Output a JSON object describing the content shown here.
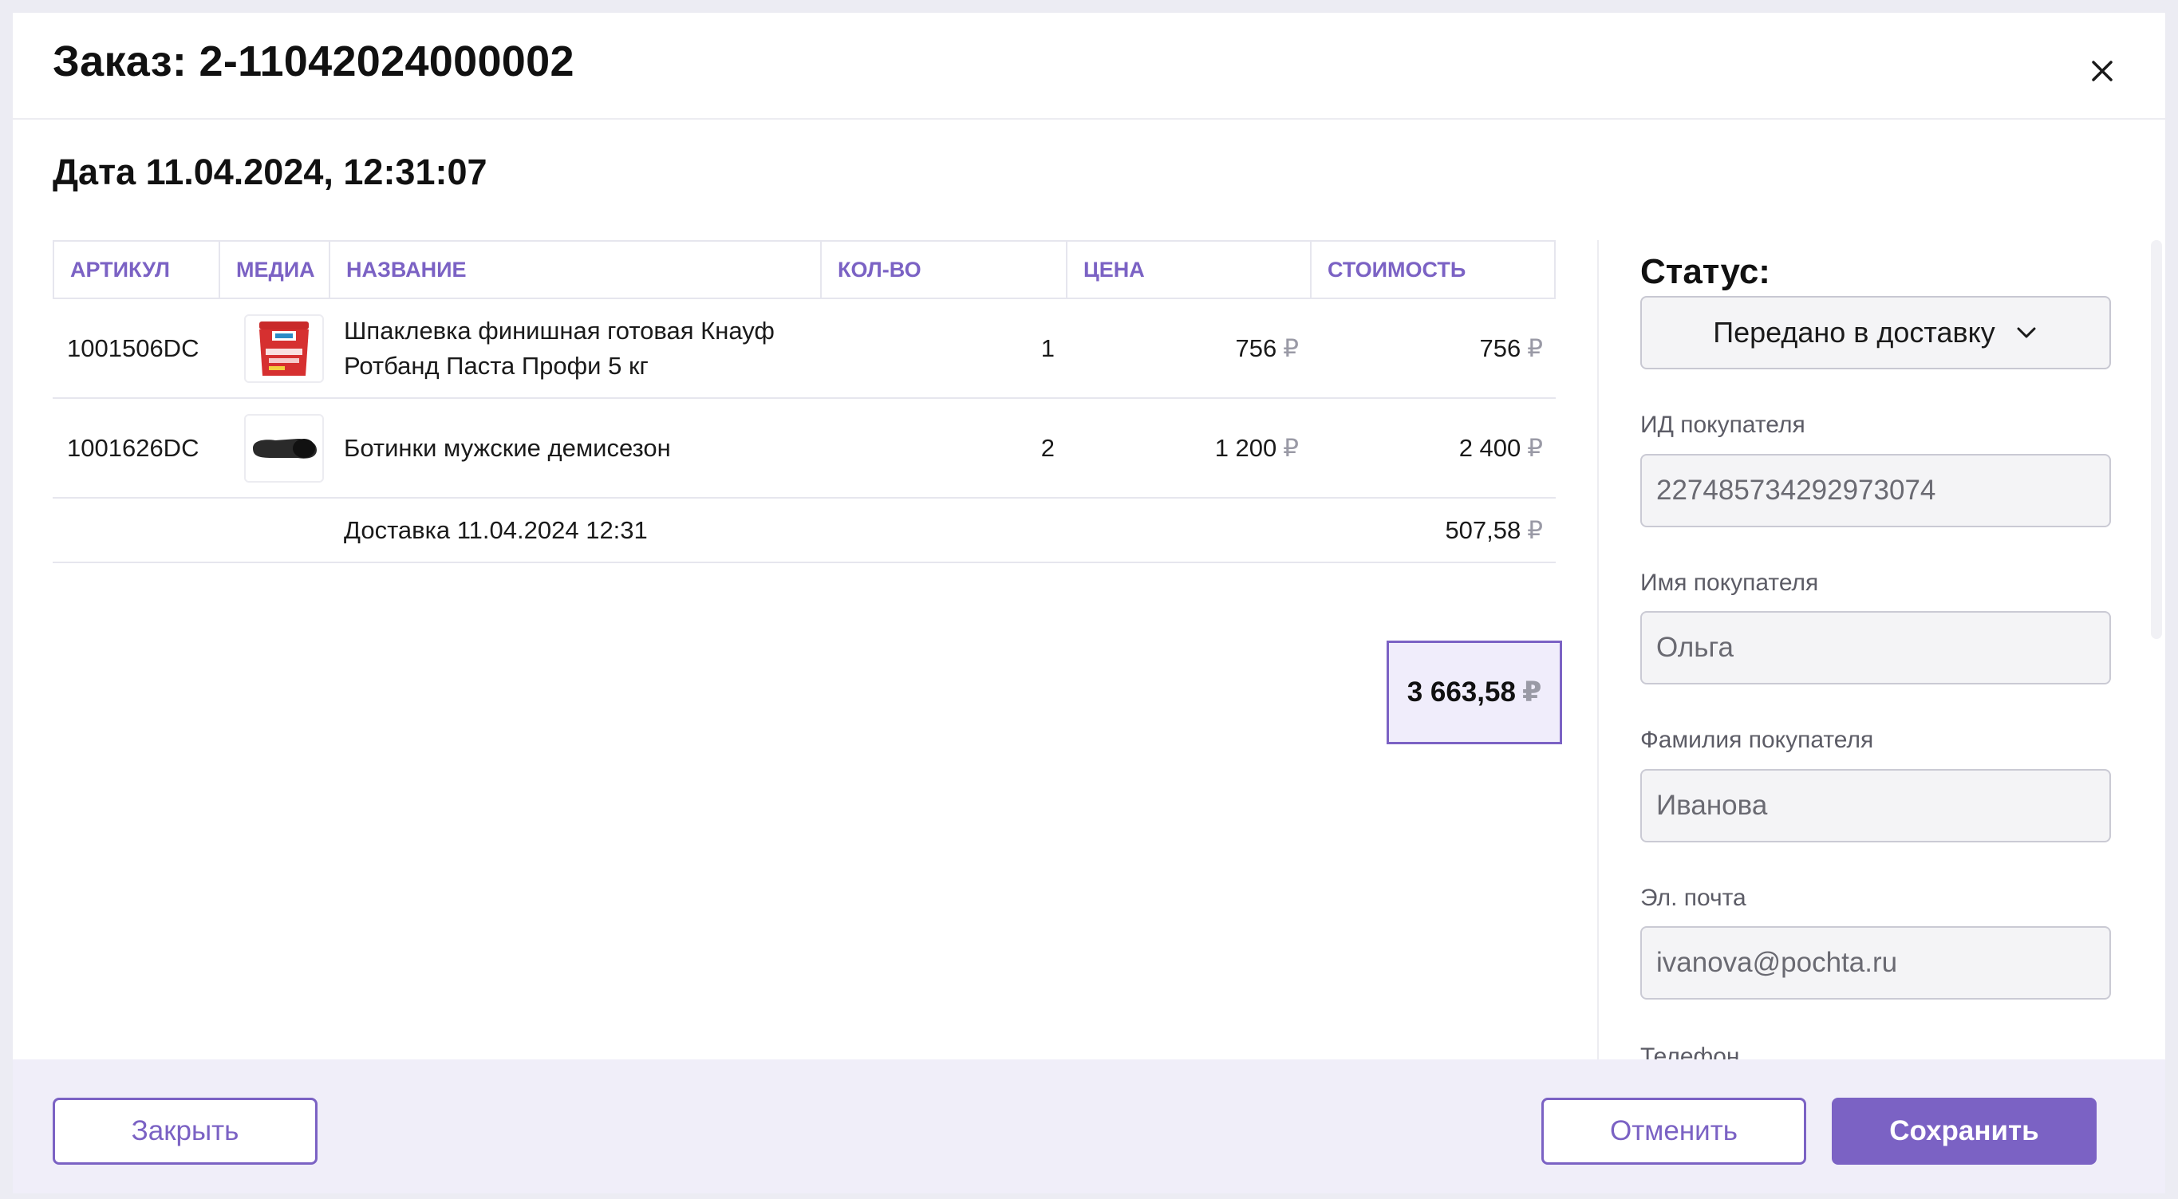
{
  "header": {
    "order_title": "Заказ: 2-11042024000002",
    "close_icon": "close-icon"
  },
  "date_title": "Дата 11.04.2024, 12:31:07",
  "table": {
    "columns": [
      "АРТИКУЛ",
      "МЕДИА",
      "НАЗВАНИЕ",
      "КОЛ-ВО",
      "ЦЕНА",
      "СТОИМОСТЬ"
    ],
    "currency": "₽",
    "rows": [
      {
        "sku": "1001506DC",
        "media": "rotband-bucket-image",
        "name_line1": "Шпаклевка финишная готовая Кнауф",
        "name_line2": "Ротбанд Паста Профи 5 кг",
        "qty": "1",
        "price": "756",
        "cost": "756"
      },
      {
        "sku": "1001626DC",
        "media": "men-boots-image",
        "name_line1": "Ботинки мужские демисезон",
        "name_line2": "",
        "qty": "2",
        "price": "1 200",
        "cost": "2 400"
      }
    ],
    "delivery": {
      "label": "Доставка 11.04.2024 12:31",
      "cost": "507,58"
    },
    "total": "3 663,58"
  },
  "sidebar": {
    "status_label": "Статус:",
    "status_value": "Передано в доставку",
    "fields": [
      {
        "label": "ИД покупателя",
        "value": "227485734292973074"
      },
      {
        "label": "Имя покупателя",
        "value": "Ольга"
      },
      {
        "label": "Фамилия покупателя",
        "value": "Иванова"
      },
      {
        "label": "Эл. почта",
        "value": "ivanova@pochta.ru"
      },
      {
        "label": "Телефон"
      }
    ]
  },
  "footer": {
    "close_label": "Закрыть",
    "cancel_label": "Отменить",
    "save_label": "Сохранить"
  },
  "colors": {
    "accent": "#7b62c4",
    "footer_bg": "#f0eef9",
    "total_bg": "#f0edfb"
  }
}
